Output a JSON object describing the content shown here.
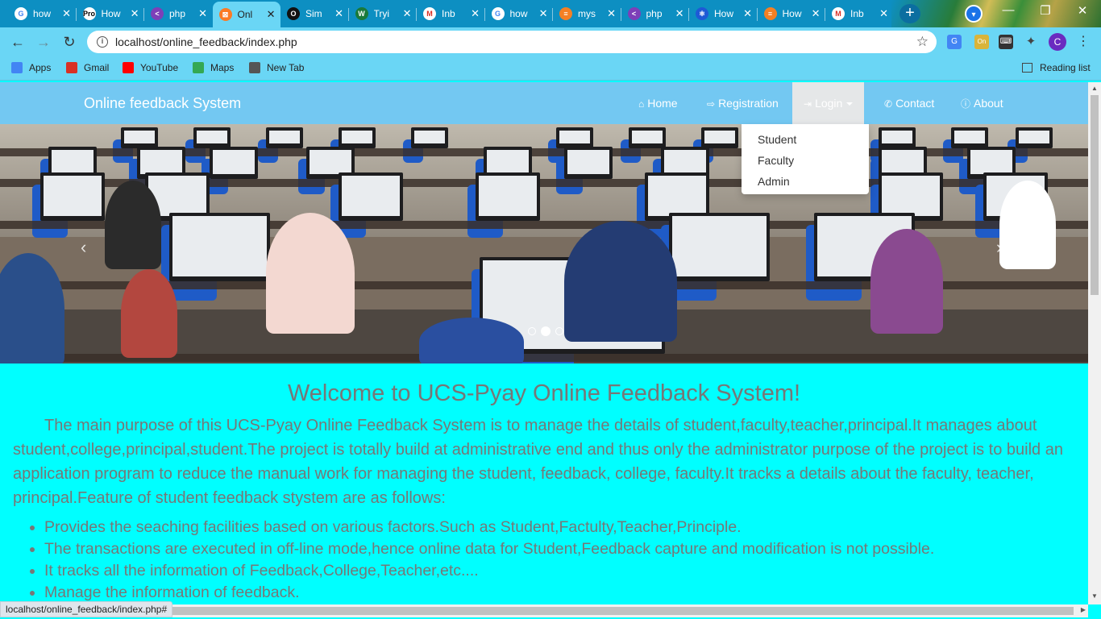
{
  "browser": {
    "tabs": [
      {
        "title": "how",
        "favicon": "google-icon",
        "color": "#ffffff",
        "fg": "#4285f4",
        "glyph": "G"
      },
      {
        "title": "How",
        "favicon": "pro-icon",
        "color": "#ffffff",
        "fg": "#000000",
        "glyph": "Pro"
      },
      {
        "title": "php",
        "favicon": "php-icon",
        "color": "#7d3fb8",
        "fg": "#ffffff",
        "glyph": "<"
      },
      {
        "title": "Onl",
        "favicon": "xampp-icon",
        "color": "#fb7a24",
        "fg": "#ffffff",
        "glyph": "⊠"
      },
      {
        "title": "Sim",
        "favicon": "opera-icon",
        "color": "#111111",
        "fg": "#ffffff",
        "glyph": "O"
      },
      {
        "title": "Tryi",
        "favicon": "w-icon",
        "color": "#1a7a3a",
        "fg": "#ffffff",
        "glyph": "W"
      },
      {
        "title": "Inb",
        "favicon": "gmail-icon",
        "color": "#ffffff",
        "fg": "#d93025",
        "glyph": "M"
      },
      {
        "title": "how",
        "favicon": "google-icon",
        "color": "#ffffff",
        "fg": "#4285f4",
        "glyph": "G"
      },
      {
        "title": "mys",
        "favicon": "stack-icon",
        "color": "#f48024",
        "fg": "#ffffff",
        "glyph": "≡"
      },
      {
        "title": "php",
        "favicon": "php-icon",
        "color": "#7d3fb8",
        "fg": "#ffffff",
        "glyph": "<"
      },
      {
        "title": "How",
        "favicon": "react-icon",
        "color": "#1e5ad6",
        "fg": "#ffffff",
        "glyph": "⚛"
      },
      {
        "title": "How",
        "favicon": "stack-icon",
        "color": "#f48024",
        "fg": "#ffffff",
        "glyph": "≡"
      },
      {
        "title": "Inb",
        "favicon": "gmail-icon",
        "color": "#ffffff",
        "fg": "#d93025",
        "glyph": "M"
      }
    ],
    "active_tab_index": 3,
    "url": "localhost/online_feedback/index.php",
    "profile_initial": "C",
    "extension_badge": "On",
    "bookmarks": [
      {
        "label": "Apps",
        "icon": "apps-grid-icon",
        "color": "#4285f4"
      },
      {
        "label": "Gmail",
        "icon": "gmail-icon",
        "color": "#d93025"
      },
      {
        "label": "YouTube",
        "icon": "youtube-icon",
        "color": "#ff0000"
      },
      {
        "label": "Maps",
        "icon": "maps-pin-icon",
        "color": "#34a853"
      },
      {
        "label": "New Tab",
        "icon": "globe-icon",
        "color": "#555555"
      }
    ],
    "reading_list": "Reading list",
    "status_url": "localhost/online_feedback/index.php#"
  },
  "site": {
    "brand": "Online feedback System",
    "nav": [
      {
        "label": "Home",
        "icon": "home-icon",
        "glyph": "⌂"
      },
      {
        "label": "Registration",
        "icon": "sign-in-icon",
        "glyph": "⇨"
      },
      {
        "label": "Login",
        "icon": "login-icon",
        "glyph": "⇥",
        "open": true
      },
      {
        "label": "Contact",
        "icon": "phone-icon",
        "glyph": "✆"
      },
      {
        "label": "About",
        "icon": "info-icon",
        "glyph": "ⓘ"
      }
    ],
    "login_menu": [
      "Student",
      "Faculty",
      "Admin"
    ],
    "carousel": {
      "slides": 3,
      "active": 1
    },
    "heading": "Welcome to UCS-Pyay Online Feedback System!",
    "intro": "The main purpose of this UCS-Pyay Online Feedback System is to manage the details of student,faculty,teacher,principal.It manages about student,college,principal,student.The project is totally build at administrative end and thus only the administrator purpose of the project is to build an application program to reduce the manual work for managing the student, feedback, college, faculty.It tracks a details about the faculty, teacher, principal.Feature of student feedback stystem are as follows:",
    "features": [
      "Provides the seaching facilities based on various factors.Such as Student,Factulty,Teacher,Principle.",
      "The transactions are executed in off-line mode,hence online data for Student,Feedback capture and modification is not possible.",
      "It tracks all the information of Feedback,College,Teacher,etc....",
      "Manage the information of feedback."
    ]
  }
}
